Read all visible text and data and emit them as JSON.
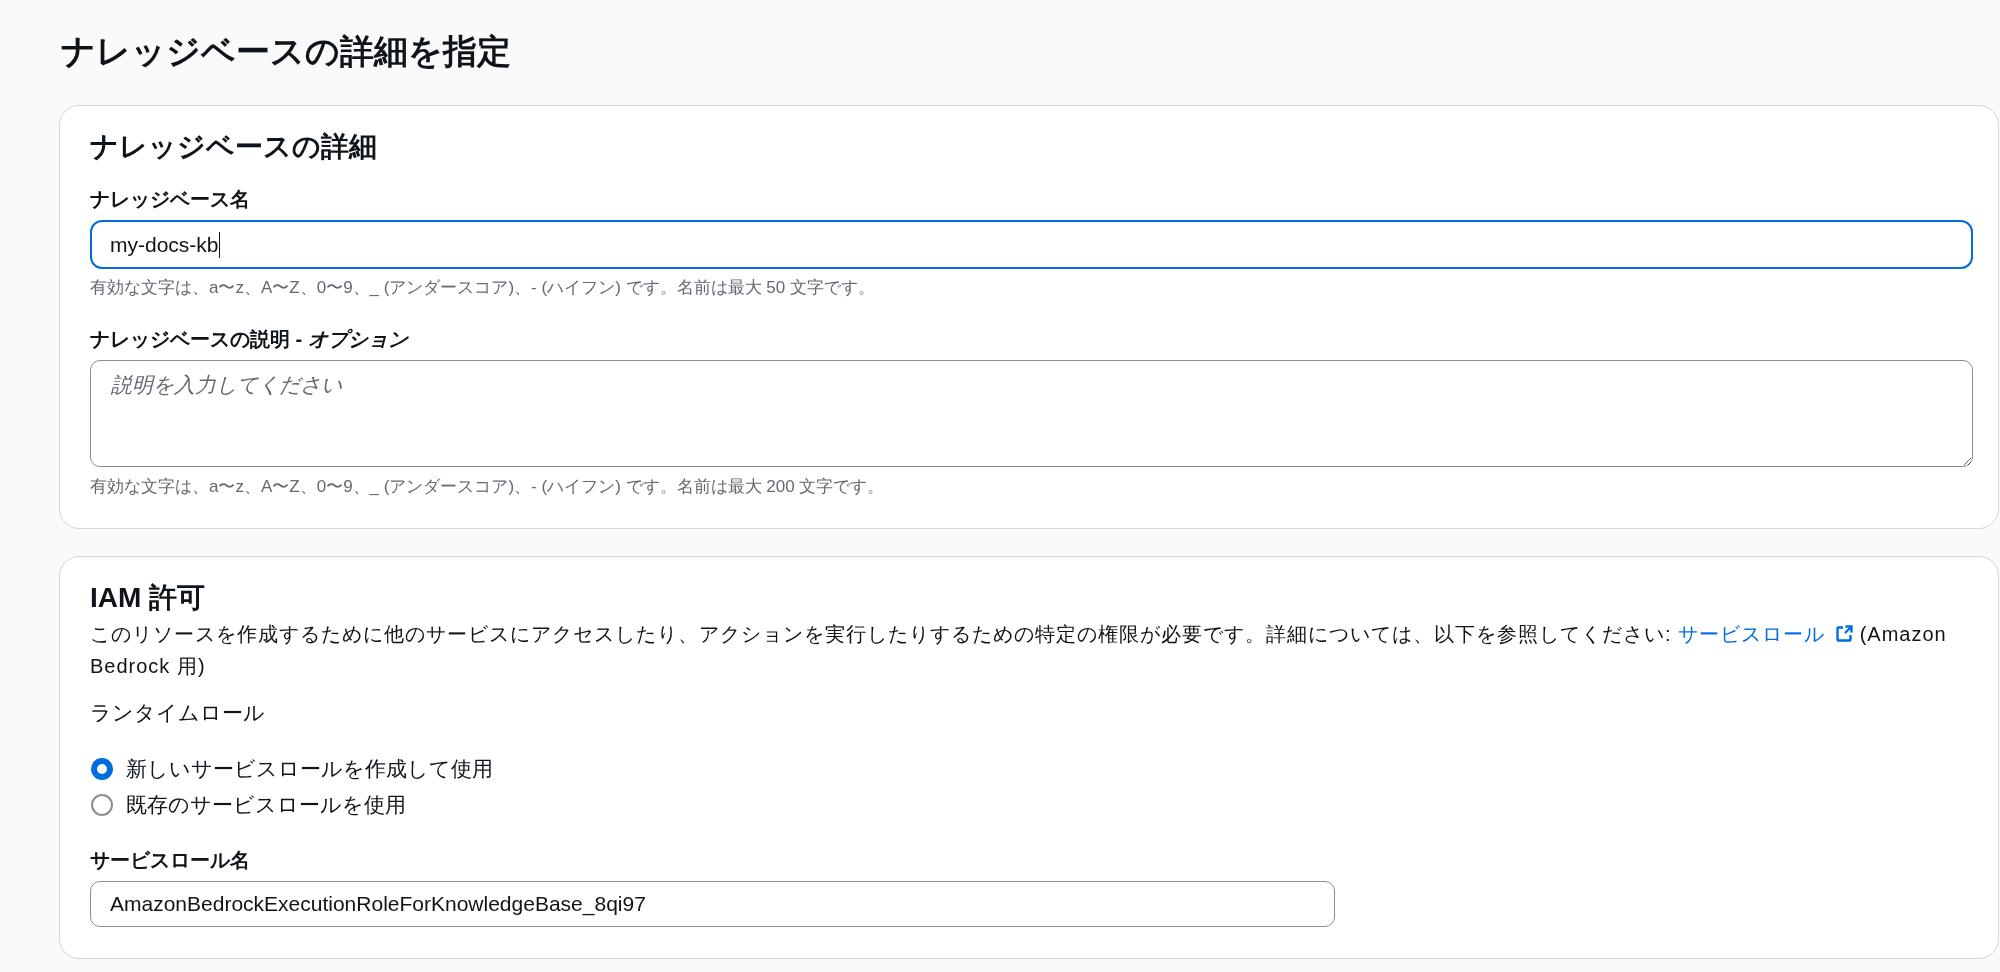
{
  "title": "ナレッジベースの詳細を指定",
  "details_card": {
    "title": "ナレッジベースの詳細",
    "name_field": {
      "label": "ナレッジベース名",
      "value": "my-docs-kb",
      "focused": true,
      "hint": "有効な文字は、a〜z、A〜Z、0〜9、_ (アンダースコア)、- (ハイフン) です。名前は最大 50 文字です。"
    },
    "description_field": {
      "label": "ナレッジベースの説明 - *オプション*",
      "placeholder": "説明を入力してください",
      "hint": "有効な文字は、a〜z、A〜Z、0〜9、_ (アンダースコア)、- (ハイフン) です。名前は最大 200 文字です。"
    }
  },
  "iam_card": {
    "title": "IAM 許可",
    "description": {
      "text": "このリソースを作成するために他のサービスにアクセスしたり、アクションを実行したりするための特定の権限が必要です。詳細については、以下を参照してください:",
      "link": "サービスロール",
      "suffix": "(Amazon Bedrock 用)"
    },
    "runtime_role": {
      "label": "ランタイムロール",
      "options": [
        {
          "label": "新しいサービスロールを作成して使用",
          "selected": true
        },
        {
          "label": "既存のサービスロールを使用",
          "selected": false
        }
      ]
    },
    "role_name_field": {
      "label": "サービスロール名",
      "value": "AmazonBedrockExecutionRoleForKnowledgeBase_8qi97"
    }
  }
}
